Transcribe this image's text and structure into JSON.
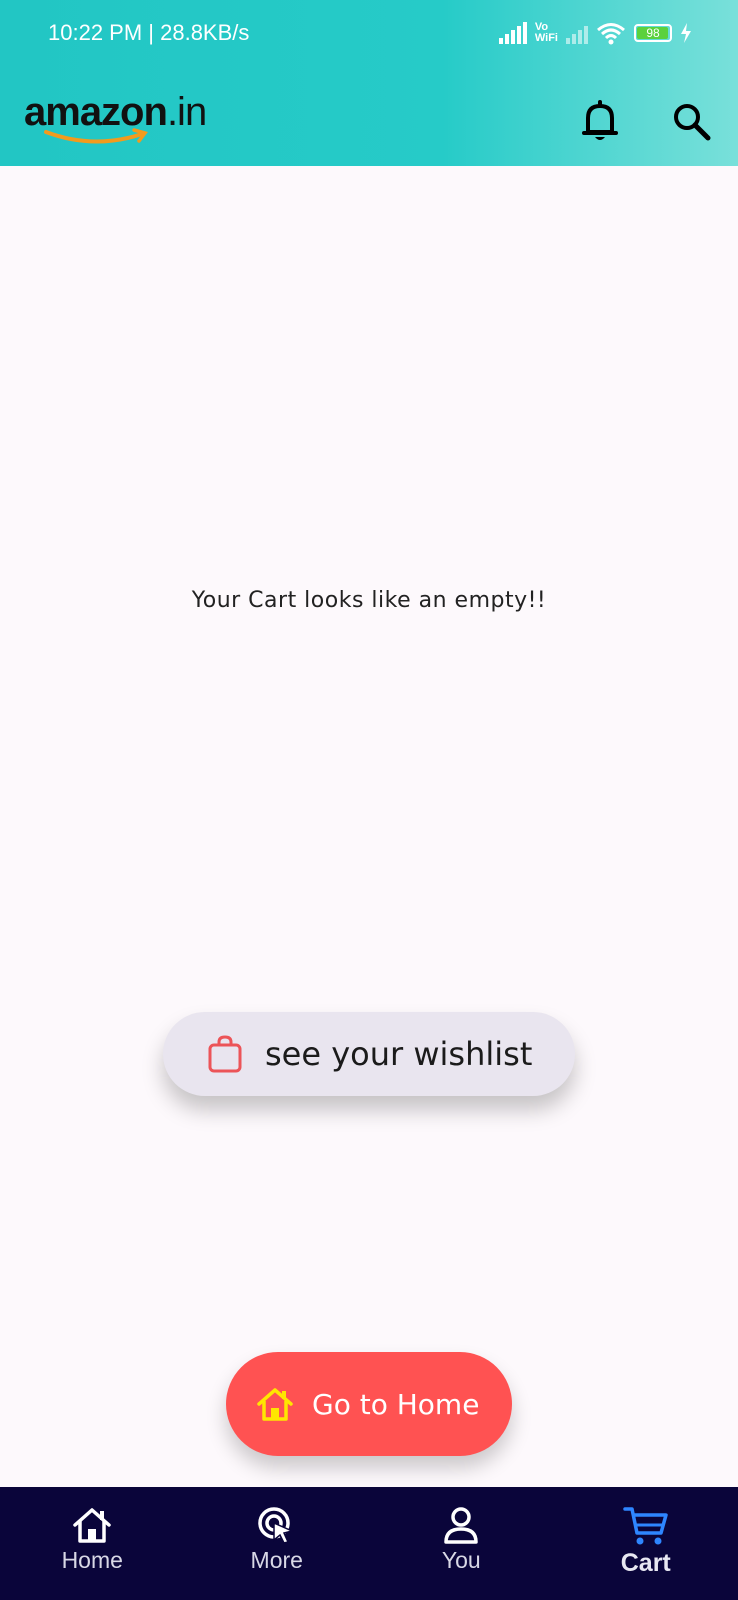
{
  "status_bar": {
    "time": "10:22 PM | 28.8KB/s",
    "vowifi_top": "Vo",
    "vowifi_bottom": "WiFi",
    "battery": "98"
  },
  "header": {
    "logo_text": "amazon",
    "logo_suffix": ".in",
    "icons": [
      "bell-icon",
      "search-icon"
    ]
  },
  "main": {
    "empty_message": "Your Cart looks like an empty!!",
    "wishlist_button": "see your wishlist",
    "home_button": "Go to Home"
  },
  "bottom_nav": {
    "items": [
      {
        "label": "Home",
        "icon": "home-icon"
      },
      {
        "label": "More",
        "icon": "cursor-click-icon"
      },
      {
        "label": "You",
        "icon": "person-icon"
      },
      {
        "label": "Cart",
        "icon": "cart-icon",
        "active": true
      }
    ]
  },
  "colors": {
    "header_teal": "#22c6c4",
    "accent_red": "#ff5252",
    "nav_bg": "#0a053a",
    "cart_active_blue": "#2e86ff",
    "wishlist_bg": "#e9e5ef",
    "home_icon_yellow": "#ffe600"
  }
}
